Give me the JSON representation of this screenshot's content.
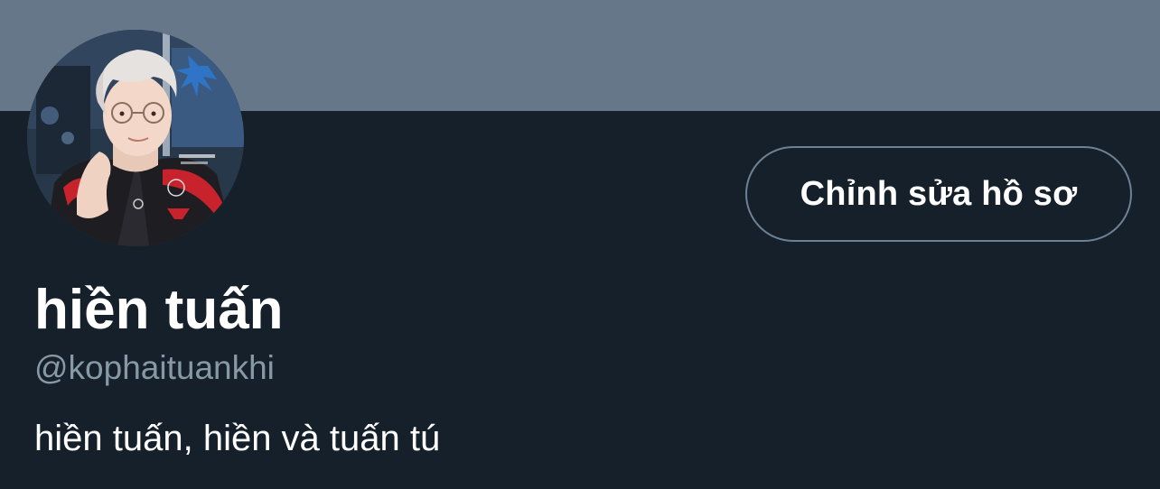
{
  "colors": {
    "background": "#15202b",
    "banner": "#66778a",
    "button_border": "#6e8093",
    "handle_text": "#8899a6",
    "primary_text": "#ffffff"
  },
  "header": {
    "banner": "profile-banner"
  },
  "profile": {
    "avatar": "profile-photo",
    "edit_button_label": "Chỉnh sửa hồ sơ",
    "display_name": "hiền tuấn",
    "handle": "@kophaituankhi",
    "bio": "hiền tuấn, hiền và tuấn tú"
  }
}
